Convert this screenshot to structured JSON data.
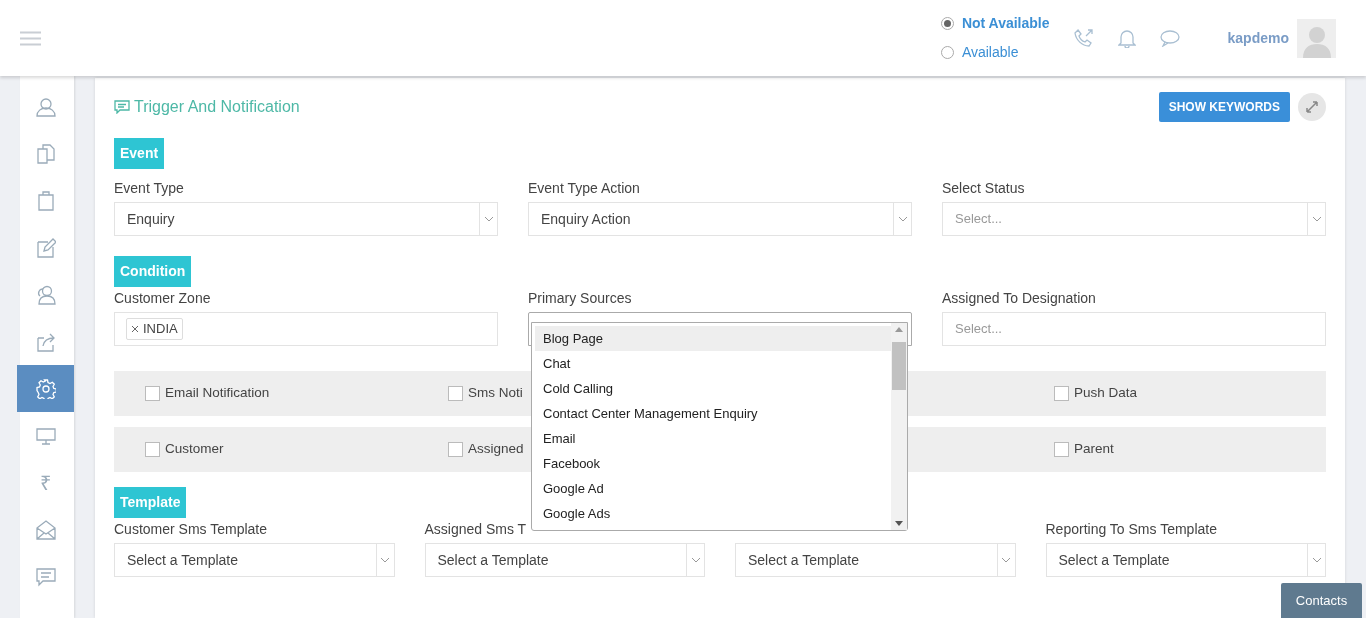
{
  "header": {
    "status_options": [
      {
        "label": "Not Available",
        "selected": true
      },
      {
        "label": "Available",
        "selected": false
      }
    ],
    "username": "kapdemo"
  },
  "sidebar": {
    "items": [
      {
        "kind": "user",
        "selected": false
      },
      {
        "kind": "copy",
        "selected": false
      },
      {
        "kind": "clipboard",
        "selected": false
      },
      {
        "kind": "edit",
        "selected": false
      },
      {
        "kind": "users",
        "selected": false
      },
      {
        "kind": "share",
        "selected": false
      },
      {
        "kind": "gear",
        "selected": true
      },
      {
        "kind": "monitor",
        "selected": false
      },
      {
        "kind": "glyph",
        "glyph": "₹",
        "selected": false
      },
      {
        "kind": "mail",
        "selected": false
      },
      {
        "kind": "chat",
        "selected": false
      }
    ]
  },
  "panel": {
    "title": "Trigger And Notification",
    "keywords_button": "SHOW KEYWORDS",
    "event": {
      "heading": "Event",
      "fields": [
        {
          "label": "Event Type",
          "value": "Enquiry"
        },
        {
          "label": "Event Type Action",
          "value": "Enquiry Action"
        },
        {
          "label": "Select Status",
          "placeholder": "Select..."
        }
      ]
    },
    "condition": {
      "heading": "Condition",
      "fields": [
        {
          "kind": "tags",
          "label": "Customer Zone",
          "tags": [
            "INDIA"
          ]
        },
        {
          "kind": "open",
          "label": "Primary Sources",
          "options": [
            {
              "label": "Blog Page",
              "selected": true
            },
            {
              "label": "Chat",
              "selected": false
            },
            {
              "label": "Cold Calling",
              "selected": false
            },
            {
              "label": "Contact Center Management Enquiry",
              "selected": false
            },
            {
              "label": "Email",
              "selected": false
            },
            {
              "label": "Facebook",
              "selected": false
            },
            {
              "label": "Google Ad",
              "selected": false
            },
            {
              "label": "Google Ads",
              "selected": false
            }
          ]
        },
        {
          "kind": "input",
          "label": "Assigned To Designation",
          "placeholder": "Select..."
        }
      ]
    },
    "checkbox_rows": [
      [
        {
          "label": "Email Notification",
          "checked": false
        },
        {
          "label": "Sms Noti",
          "checked": false
        },
        {
          "label": "Push Data",
          "checked": false
        }
      ],
      [
        {
          "label": "Customer",
          "checked": false
        },
        {
          "label": "Assigned",
          "checked": false
        },
        {
          "label": "Parent",
          "checked": false
        }
      ]
    ],
    "template": {
      "heading": "Template",
      "fields": [
        {
          "label": "Customer Sms Template",
          "value": "Select a Template"
        },
        {
          "label": "Assigned Sms T",
          "value": "Select a Template"
        },
        {
          "value": "Select a Template"
        },
        {
          "label": "Reporting To Sms Template",
          "value": "Select a Template"
        }
      ]
    }
  },
  "contacts_button": "Contacts"
}
